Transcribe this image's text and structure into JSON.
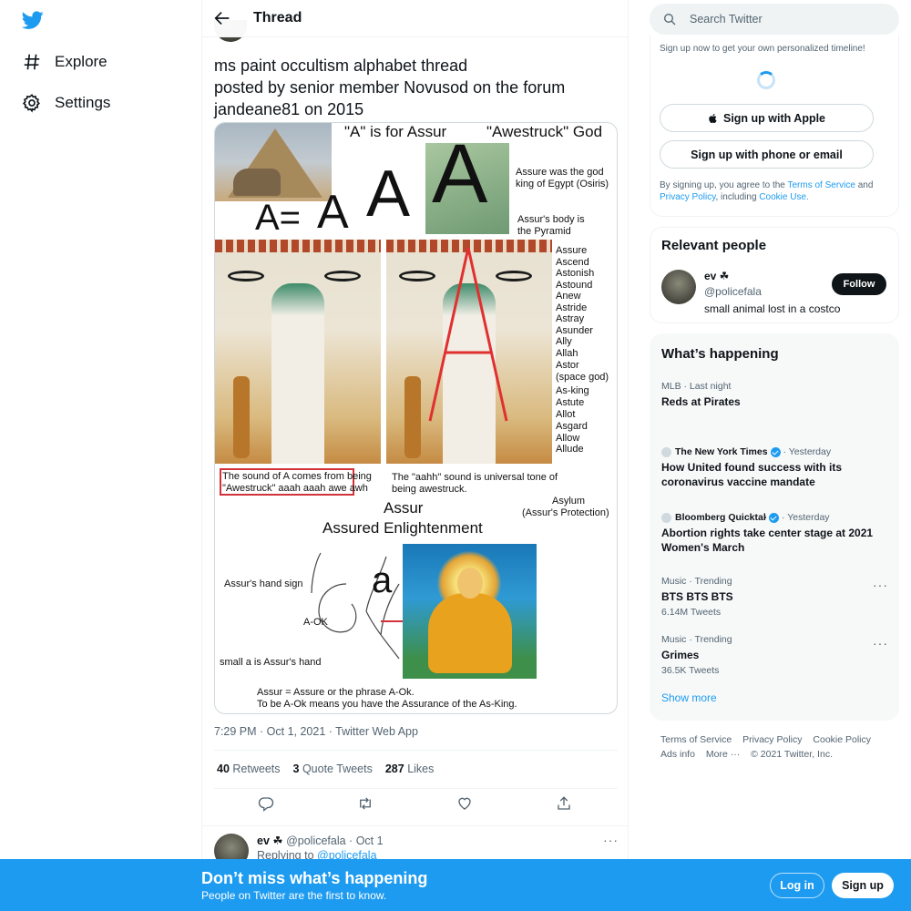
{
  "nav": {
    "items": [
      {
        "label": "Explore",
        "icon": "hashtag-icon"
      },
      {
        "label": "Settings",
        "icon": "gear-icon"
      }
    ]
  },
  "header": {
    "title": "Thread"
  },
  "tweet": {
    "text_lines": [
      "ms paint occultism alphabet thread",
      "posted by senior member Novusod on the forum",
      "jandeane81 on 2015"
    ],
    "timestamp": "7:29 PM · Oct 1, 2021 · Twitter Web App",
    "stats": {
      "retweets_count": "40",
      "retweets_label": "Retweets",
      "quotes_count": "3",
      "quotes_label": "Quote Tweets",
      "likes_count": "287",
      "likes_label": "Likes"
    }
  },
  "media": {
    "title1": "\"A\" is for Assur",
    "title2": "\"Awestruck\" God",
    "equation": "A=",
    "letter_a": "A",
    "note1_line1": "Assure was the god",
    "note1_line2": "king of Egypt (Osiris)",
    "note2_line1": "Assur's body is",
    "note2_line2": "the Pyramid",
    "words": [
      "Assure",
      "Ascend",
      "Astonish",
      "Astound",
      "Anew",
      "Astride",
      "Astray",
      "Asunder",
      "Ally",
      "Allah",
      "Astor",
      "(space god)",
      "As-king",
      "Astute",
      "Allot",
      "Asgard",
      "Allow",
      "Allude"
    ],
    "sound_line1": "The sound of A comes from being",
    "sound_line2": "\"Awestruck\" aaah aaah awe awh",
    "aahh_line1": "The \"aahh\" sound is universal tone of",
    "aahh_line2": "being awestruck.",
    "asylum_line1": "Asylum",
    "asylum_line2": "(Assur's Protection)",
    "assur": "Assur",
    "assured": "Assured Enlightenment",
    "hand_sign": "Assur's hand sign",
    "aok": "A-OK",
    "small_a_letter": "a",
    "small_a": "small a is Assur's  hand",
    "bottom_line1": "Assur = Assure or the phrase A-Ok.",
    "bottom_line2": "To be A-Ok means you have the Assurance of the As-King."
  },
  "reply": {
    "name": "ev ☘",
    "handle_time": "@policefala · Oct 1",
    "replying_prefix": "Replying to",
    "replying_handle": "@policefala"
  },
  "search": {
    "placeholder": "Search Twitter"
  },
  "signup_card": {
    "subtitle": "Sign up now to get your own personalized timeline!",
    "apple_label": "Sign up with Apple",
    "phone_label": "Sign up with phone or email",
    "terms_prefix": "By signing up, you agree to the",
    "terms_link": "Terms of Service",
    "terms_and": "and",
    "privacy_link": "Privacy Policy",
    "terms_including": ", including",
    "cookie_link": "Cookie Use."
  },
  "relevant": {
    "title": "Relevant people",
    "name": "ev ☘",
    "handle": "@policefala",
    "bio": "small animal lost in a costco",
    "follow_label": "Follow"
  },
  "happening": {
    "title": "What’s happening",
    "trends": [
      {
        "meta": "MLB · Last night",
        "title": "Reds at Pirates"
      },
      {
        "source": "The New York Times",
        "time": "· Yesterday",
        "title": "How United found success with its coronavirus vaccine mandate"
      },
      {
        "source": "Bloomberg Quicktake",
        "time": "· Yesterday",
        "title": "Abortion rights take center stage at 2021 Women's March"
      },
      {
        "meta": "Music · Trending",
        "title": "BTS BTS BTS",
        "count": "6.14M Tweets"
      },
      {
        "meta": "Music · Trending",
        "title": "Grimes",
        "count": "36.5K Tweets"
      }
    ],
    "show_more": "Show more"
  },
  "footer": {
    "links": [
      "Terms of Service",
      "Privacy Policy",
      "Cookie Policy",
      "Ads info",
      "More ···",
      "© 2021 Twitter, Inc."
    ]
  },
  "bottom_bar": {
    "title": "Don’t miss what’s happening",
    "subtitle": "People on Twitter are the first to know.",
    "login_label": "Log in",
    "signup_label": "Sign up"
  },
  "colors": {
    "accent": "#1d9bf0",
    "text": "#0f1419",
    "secondary": "#536471"
  }
}
